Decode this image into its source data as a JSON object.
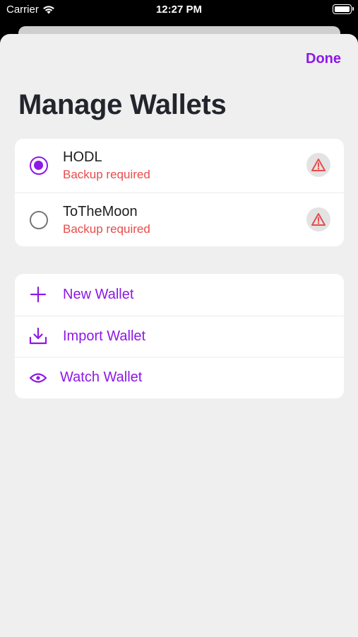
{
  "status_bar": {
    "carrier": "Carrier",
    "time": "12:27 PM"
  },
  "header": {
    "done_label": "Done",
    "title": "Manage Wallets"
  },
  "wallets": [
    {
      "name": "HODL",
      "status": "Backup required",
      "selected": true
    },
    {
      "name": "ToTheMoon",
      "status": "Backup required",
      "selected": false
    }
  ],
  "actions": [
    {
      "label": "New Wallet",
      "icon": "plus-icon"
    },
    {
      "label": "Import Wallet",
      "icon": "download-icon"
    },
    {
      "label": "Watch Wallet",
      "icon": "eye-icon"
    }
  ],
  "colors": {
    "accent": "#8e18e6",
    "warning": "#e94b4b",
    "background": "#efefef",
    "card": "#ffffff"
  }
}
